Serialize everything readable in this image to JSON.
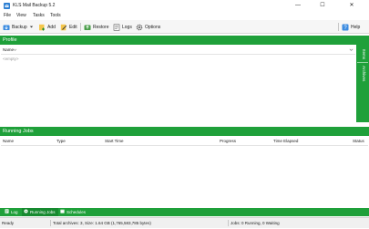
{
  "window": {
    "title": "KLS Mail Backup 5.2",
    "minimize_glyph": "—",
    "maximize_glyph": "☐",
    "close_glyph": "✕"
  },
  "menu": [
    "File",
    "View",
    "Tasks",
    "Tools"
  ],
  "toolbar": {
    "backup": "Backup",
    "add": "Add",
    "edit": "Edit",
    "restore": "Restore",
    "logs": "Logs",
    "options": "Options",
    "help": "Help"
  },
  "profile": {
    "header": "Profile",
    "column_name": "Name",
    "empty_text": "<empty>",
    "side_tabs": [
      "Items",
      "Archives"
    ]
  },
  "running_jobs": {
    "header": "Running Jobs",
    "columns": [
      "Name",
      "Type",
      "Start Time",
      "Progress",
      "Time Elapsed",
      "Status"
    ]
  },
  "bottom_tabs": [
    {
      "label": "Log",
      "icon": "log-icon"
    },
    {
      "label": "Running Jobs",
      "icon": "running-jobs-icon",
      "active": true
    },
    {
      "label": "Schedules",
      "icon": "schedules-icon"
    }
  ],
  "status": {
    "ready": "Ready",
    "archives": "Total archives: 3, Size: 1.64 GB (1,765,583,785 bytes)",
    "jobs": "Jobs: 0 Running, 0 Waiting"
  },
  "colors": {
    "accent": "#1fa03a",
    "toolbar_bg": "#f6f6f6"
  }
}
